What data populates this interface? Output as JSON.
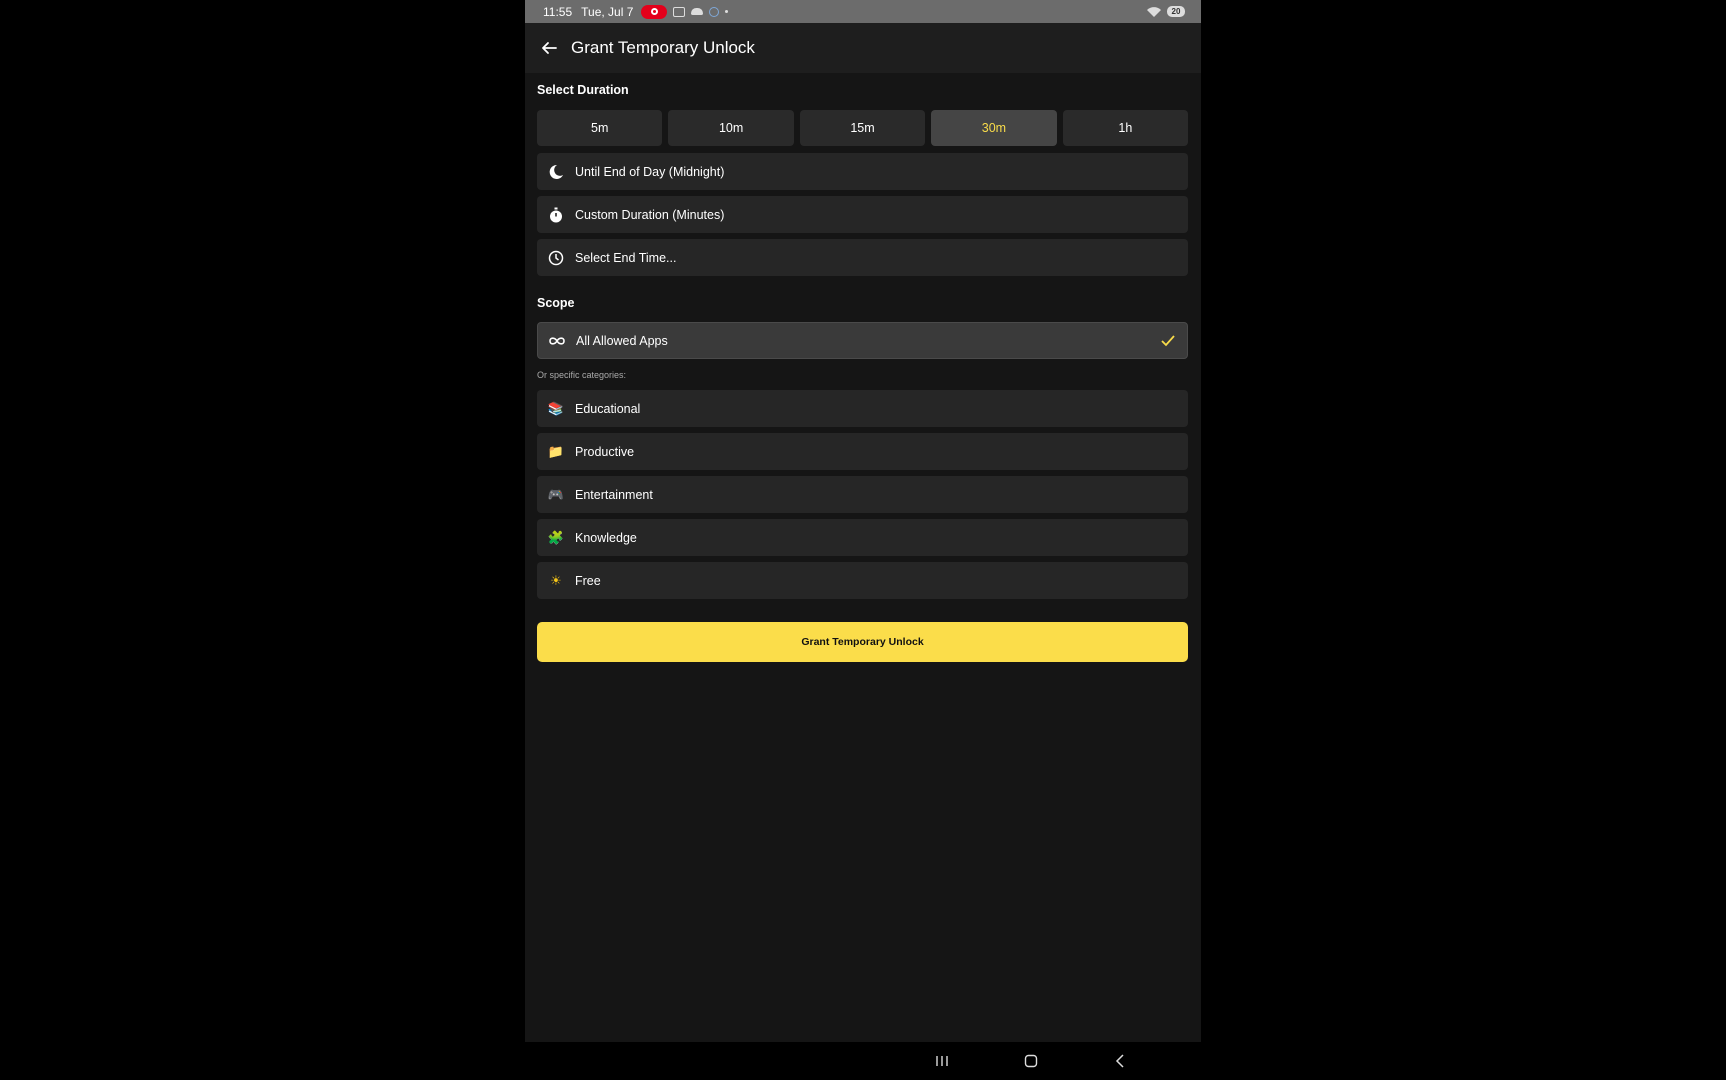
{
  "status_bar": {
    "time": "11:55",
    "date": "Tue, Jul 7",
    "battery": "20",
    "icons": [
      "record-icon",
      "screenshot-icon",
      "cloud-icon",
      "sync-icon",
      "wifi-icon",
      "battery-icon"
    ]
  },
  "app_bar": {
    "title": "Grant Temporary Unlock",
    "back_icon": "arrow-left-icon"
  },
  "duration": {
    "label": "Select Duration",
    "options": [
      {
        "label": "5m",
        "selected": false
      },
      {
        "label": "10m",
        "selected": false
      },
      {
        "label": "15m",
        "selected": false
      },
      {
        "label": "30m",
        "selected": true
      },
      {
        "label": "1h",
        "selected": false
      }
    ],
    "rows": [
      {
        "label": "Until End of Day (Midnight)",
        "icon": "moon-icon"
      },
      {
        "label": "Custom Duration (Minutes)",
        "icon": "stopwatch-icon"
      },
      {
        "label": "Select End Time...",
        "icon": "clock-icon"
      }
    ]
  },
  "scope": {
    "label": "Scope",
    "all_apps": {
      "label": "All Allowed Apps",
      "icon": "infinity-icon",
      "selected": true
    },
    "sub_label": "Or specific categories:",
    "categories": [
      {
        "label": "Educational",
        "icon": "books-icon",
        "glyph": "📚"
      },
      {
        "label": "Productive",
        "icon": "folder-icon",
        "glyph": "📁"
      },
      {
        "label": "Entertainment",
        "icon": "gamepad-icon",
        "glyph": "🎮"
      },
      {
        "label": "Knowledge",
        "icon": "puzzle-icon",
        "glyph": "🧩"
      },
      {
        "label": "Free",
        "icon": "sun-icon",
        "glyph": "☀"
      }
    ]
  },
  "grant_button": {
    "label": "Grant Temporary Unlock"
  },
  "colors": {
    "accent": "#fbdd4a",
    "selected_text": "#f9dc4a",
    "background": "#151515",
    "surface": "#262626"
  },
  "nav_bar": {
    "icons": [
      "recents-icon",
      "home-icon",
      "back-icon"
    ]
  }
}
